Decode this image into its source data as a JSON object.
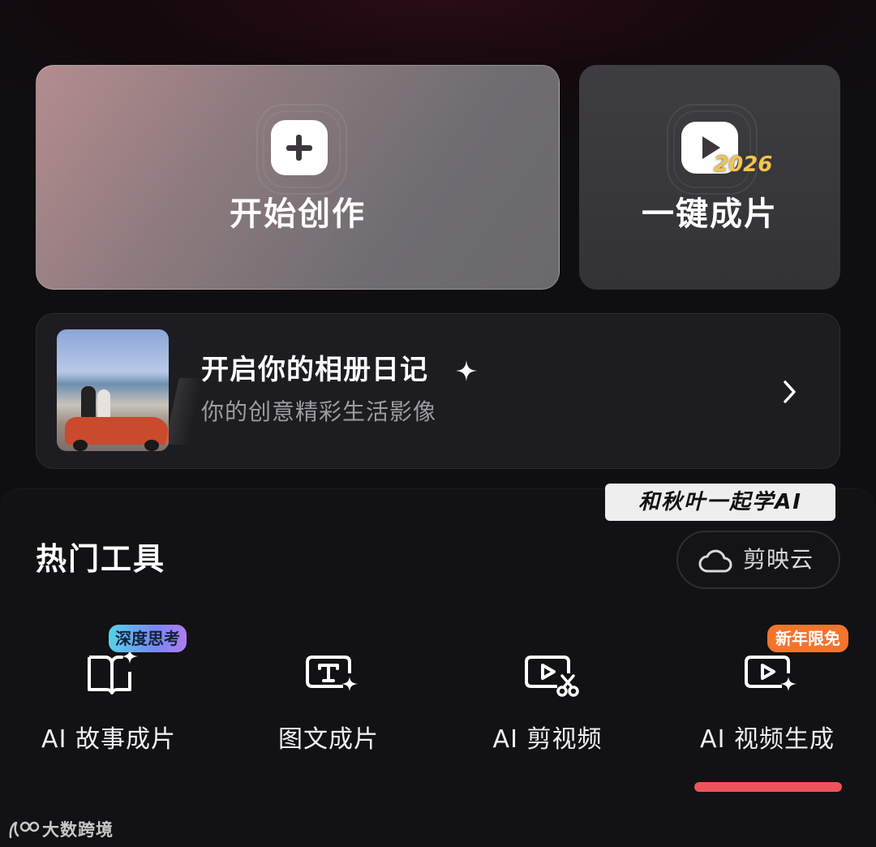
{
  "cards": {
    "start": {
      "label": "开始创作",
      "icon": "plus-icon"
    },
    "one_click": {
      "label": "一键成片",
      "icon": "play-icon",
      "badge_year": "2026"
    }
  },
  "album": {
    "title": "开启你的相册日记",
    "subtitle": "你的创意精彩生活影像",
    "icons": [
      "sparkle-icon",
      "chevron-right-icon"
    ]
  },
  "watermark": {
    "text": "和秋叶一起学AI"
  },
  "hot_tools": {
    "title": "热门工具",
    "cloud_button": {
      "label": "剪映云",
      "icon": "cloud-icon"
    },
    "items": [
      {
        "label": "AI 故事成片",
        "icon": "book-sparkle-icon",
        "badge": "深度思考"
      },
      {
        "label": "图文成片",
        "icon": "text-frame-icon"
      },
      {
        "label": "AI 剪视频",
        "icon": "video-scissors-icon"
      },
      {
        "label": "AI 视频生成",
        "icon": "video-sparkle-icon",
        "badge": "新年限免",
        "selected": true
      }
    ]
  },
  "brand": {
    "text": "大数跨境",
    "icon": "brand-logo-icon"
  },
  "colors": {
    "accent_underline": "#f0525c",
    "badge_new": "#f2742d",
    "badge_year": "#f2c64b",
    "badge_deep_start": "#55d3e8",
    "badge_deep_end": "#b07cf2"
  }
}
